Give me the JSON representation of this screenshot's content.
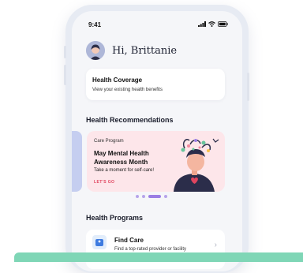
{
  "status_bar": {
    "time": "9:41"
  },
  "greeting": "Hi, Brittanie",
  "coverage": {
    "title": "Health Coverage",
    "subtitle": "View your existing health benefits"
  },
  "recommendations": {
    "heading": "Health Recommendations",
    "promo": {
      "tag": "Care Program",
      "title": "May Mental Health Awareness Month",
      "description": "Take a moment for self-care!",
      "link": "LET'S GO"
    },
    "pagination": {
      "count": 4,
      "active_index": 2
    }
  },
  "programs": {
    "heading": "Health Programs",
    "find_care": {
      "title": "Find Care",
      "subtitle": "Find a top-rated provider or facility"
    }
  },
  "colors": {
    "promo_bg": "#fde6ea",
    "accent_purple": "#9b7fe4",
    "link_red": "#e0455f",
    "bottom_bar": "#7fd6b6"
  },
  "icons": [
    "signal-icon",
    "wifi-icon",
    "battery-icon",
    "avatar",
    "mental-health-illustration",
    "find-care-icon",
    "chevron-right-icon"
  ]
}
